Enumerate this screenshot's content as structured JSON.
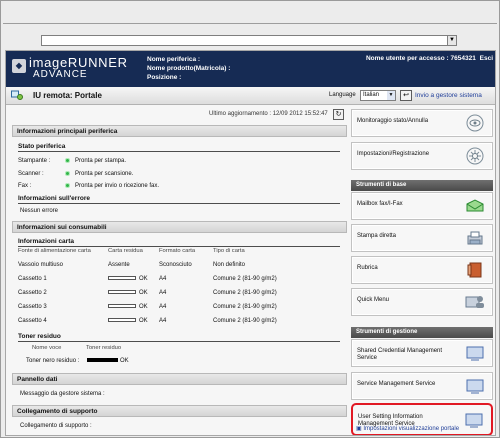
{
  "browser": {
    "address": ""
  },
  "header": {
    "product_name": "imageRUNNER",
    "product_sub": "ADVANCE",
    "device_name_label": "Nome periferica :",
    "product_model_label": "Nome prodotto(Matricola) :",
    "position_label": "Posizione :",
    "login_user_label": "Nome utente per accesso :",
    "login_user_value": "7654321",
    "logout_label": "Esci"
  },
  "titlebar": {
    "page_title": "IU remota: Portale",
    "language_label": "Language",
    "language_value": "Italian",
    "admin_link": "Invio a gestore sistema"
  },
  "main": {
    "last_updated": "Ultimo aggiornamento : 12/09 2012 15:52:47",
    "device_info_title": "Informazioni principali periferica",
    "device_status_title": "Stato periferica",
    "statuses": [
      {
        "label": "Stampante :",
        "value": "Pronta per stampa."
      },
      {
        "label": "Scanner :",
        "value": "Pronta per scansione."
      },
      {
        "label": "Fax :",
        "value": "Pronta per invio o ricezione fax."
      }
    ],
    "error_title": "Informazioni sull'errore",
    "error_value": "Nessun errore",
    "consumables_title": "Informazioni sui consumabili",
    "paper_title": "Informazioni carta",
    "paper_columns": [
      "Fonte di alimentazione carta",
      "Carta residua",
      "Formato carta",
      "Tipo di carta"
    ],
    "paper_rows": [
      {
        "source": "Vassoio multiuso",
        "remaining": "Assente",
        "size": "Sconosciuto",
        "type": "Non definito"
      },
      {
        "source": "Cassetto 1",
        "remaining": "OK",
        "size": "A4",
        "type": "Comune 2 (81-90 g/m2)"
      },
      {
        "source": "Cassetto 2",
        "remaining": "OK",
        "size": "A4",
        "type": "Comune 2 (81-90 g/m2)"
      },
      {
        "source": "Cassetto 3",
        "remaining": "OK",
        "size": "A4",
        "type": "Comune 2 (81-90 g/m2)"
      },
      {
        "source": "Cassetto 4",
        "remaining": "OK",
        "size": "A4",
        "type": "Comune 2 (81-90 g/m2)"
      }
    ],
    "toner_title": "Toner residuo",
    "toner_columns": [
      "Nome voce",
      "Toner residuo"
    ],
    "toner_row": {
      "name": "Toner nero residuo :",
      "value": "OK"
    },
    "data_panel_title": "Pannello dati",
    "system_message_label": "Messaggio da gestore sistema :",
    "support_title": "Collegamento di supporto",
    "support_label": "Collegamento di supporto :"
  },
  "sidebar": {
    "items": [
      {
        "label": "Monitoraggio stato/Annulla"
      },
      {
        "label": "Impostazioni/Registrazione"
      }
    ],
    "basic_title": "Strumenti di base",
    "basic_tools": [
      {
        "label": "Mailbox fax/I-Fax"
      },
      {
        "label": "Stampa diretta"
      },
      {
        "label": "Rubrica"
      },
      {
        "label": "Quick Menu"
      }
    ],
    "management_title": "Strumenti di gestione",
    "management_tools": [
      {
        "label": "Shared Credential Management Service"
      },
      {
        "label": "Service Management Service"
      },
      {
        "label": "User Setting Information Management Service"
      }
    ],
    "footer_link": "Impostazioni visualizzazione portale"
  },
  "colors": {
    "header": "#162b54",
    "status_ok": "#31b448",
    "highlight": "#e11924",
    "link": "#22409a"
  }
}
